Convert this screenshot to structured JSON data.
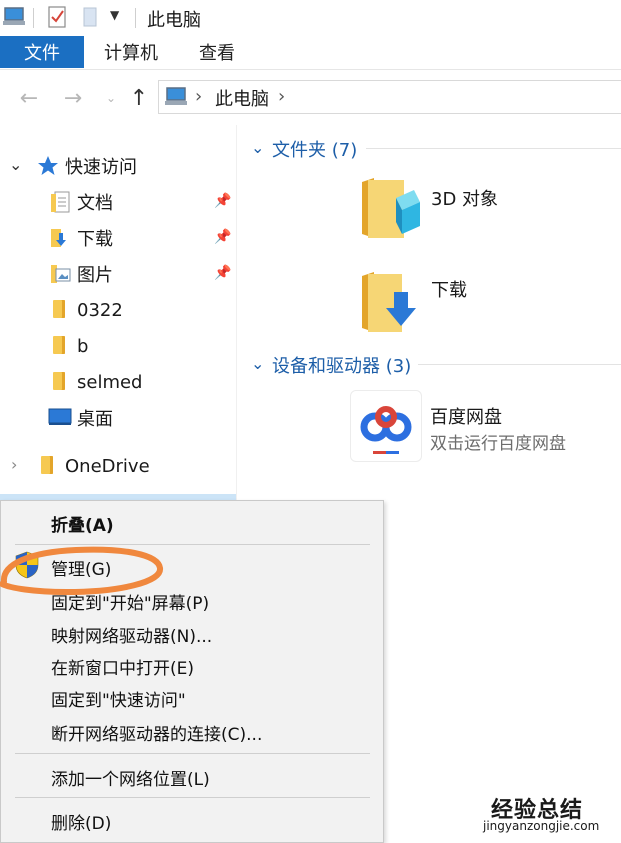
{
  "window": {
    "title": "此电脑"
  },
  "ribbon": {
    "tabs": [
      "文件",
      "计算机",
      "查看"
    ]
  },
  "address": {
    "path": "此电脑",
    "chevron": "›"
  },
  "nav": {
    "quick_access": "快速访问",
    "items": [
      {
        "label": "文档",
        "pinned": true,
        "icon": "documents-folder-icon"
      },
      {
        "label": "下载",
        "pinned": true,
        "icon": "downloads-folder-icon"
      },
      {
        "label": "图片",
        "pinned": true,
        "icon": "pictures-folder-icon"
      },
      {
        "label": "0322",
        "pinned": false,
        "icon": "folder-icon"
      },
      {
        "label": "b",
        "pinned": false,
        "icon": "folder-icon"
      },
      {
        "label": "selmed",
        "pinned": false,
        "icon": "folder-icon"
      },
      {
        "label": "桌面",
        "pinned": false,
        "icon": "desktop-icon"
      }
    ],
    "onedrive": "OneDrive"
  },
  "content": {
    "folders_header": "文件夹 (7)",
    "folders": [
      {
        "label": "3D 对象",
        "icon": "3d-objects-folder-icon"
      },
      {
        "label": "下载",
        "icon": "downloads-folder-icon"
      }
    ],
    "devices_header": "设备和驱动器 (3)",
    "devices": [
      {
        "label": "百度网盘",
        "sublabel": "双击运行百度网盘",
        "icon": "baidu-netdisk-icon"
      }
    ]
  },
  "context_menu": {
    "items": [
      "折叠(A)",
      "管理(G)",
      "固定到\"开始\"屏幕(P)",
      "映射网络驱动器(N)...",
      "在新窗口中打开(E)",
      "固定到\"快速访问\"",
      "断开网络驱动器的连接(C)...",
      "添加一个网络位置(L)",
      "删除(D)"
    ]
  },
  "watermark": {
    "text": "经验总结",
    "url": "jingyanzongjie.com"
  },
  "colors": {
    "accent": "#1b6fc2",
    "highlight_circle": "#f0883e",
    "header_blue": "#1d5ea8"
  }
}
